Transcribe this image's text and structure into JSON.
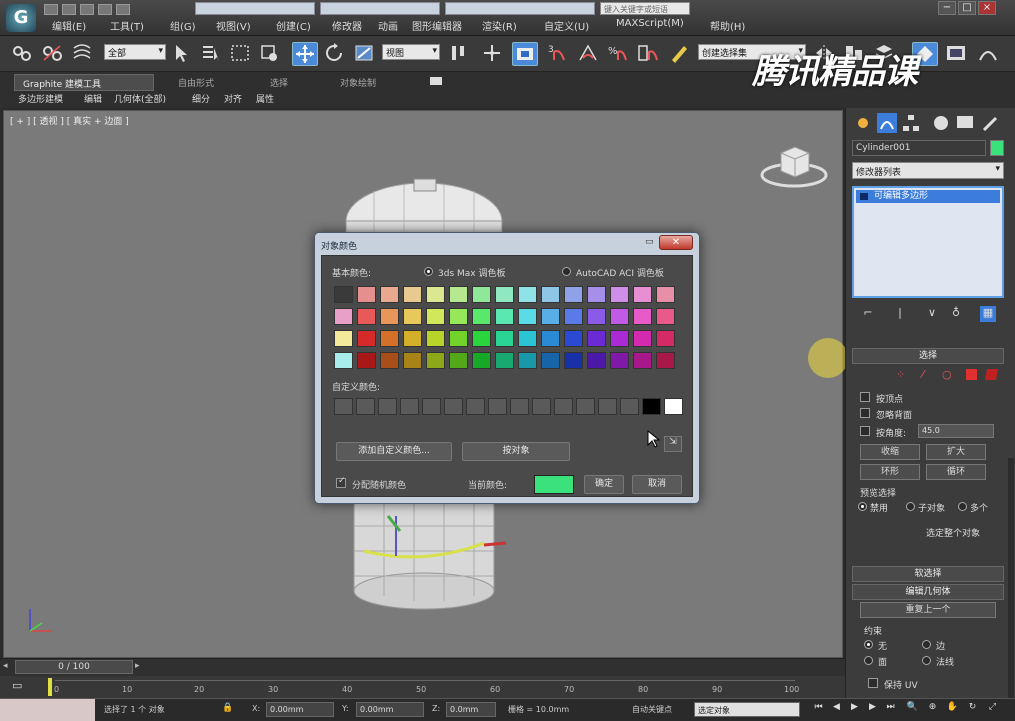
{
  "menubar": {
    "quick_access": [
      "new-icon",
      "open-icon",
      "save-icon",
      "undo-icon",
      "redo-icon"
    ],
    "title_tabs": [
      "",
      "",
      ""
    ],
    "search_placeholder": "键入关键字或短语",
    "items": [
      "编辑(E)",
      "工具(T)",
      "组(G)",
      "视图(V)",
      "创建(C)",
      "修改器",
      "动画",
      "图形编辑器",
      "渲染(R)",
      "自定义(U)",
      "MAXScript(M)",
      "帮助(H)"
    ]
  },
  "toolbar": {
    "filter_value": "全部",
    "ref_coord_value": "视图",
    "named_selection_value": "创建选择集"
  },
  "ribbon": {
    "tabs": [
      "Graphite 建模工具",
      "自由形式",
      "选择",
      "对象绘制"
    ],
    "subtabs": [
      "多边形建模",
      "编辑",
      "几何体(全部)",
      "细分",
      "对齐",
      "属性"
    ],
    "watermark": "腾讯精品课"
  },
  "viewport": {
    "label": "[ + ] [ 透视 ] [ 真实 + 边面 ]"
  },
  "command_panel": {
    "object_name": "Cylinder001",
    "object_color": "#3be27b",
    "modifier_list": "修改器列表",
    "stack_item": "可编辑多边形",
    "selection_title": "选择",
    "by_vertex": "按顶点",
    "ignore_backfacing": "忽略背面",
    "by_angle": "按角度:",
    "angle_value": "45.0",
    "shrink": "收缩",
    "grow": "扩大",
    "ring": "环形",
    "loop": "循环",
    "preview_selection": "预览选择",
    "preview_off": "禁用",
    "preview_subobj": "子对象",
    "preview_multi": "多个",
    "selected_info": "选定整个对象",
    "soft_selection": "软选择",
    "edit_geometry": "编辑几何体",
    "repeat_last": "重复上一个",
    "constraints": "约束",
    "c_none": "无",
    "c_edge": "边",
    "c_face": "面",
    "c_normal": "法线",
    "preserve_uv": "保持 UV"
  },
  "dialog": {
    "title": "对象颜色",
    "basic_colors": "基本颜色:",
    "palette_3dsmax": "3ds Max 调色板",
    "palette_autocad": "AutoCAD ACI 调色板",
    "custom_colors": "自定义颜色:",
    "add_custom": "添加自定义颜色...",
    "by_object": "按对象",
    "assign_random": "分配随机颜色",
    "current_color_label": "当前颜色:",
    "current_color": "#3be27b",
    "ok": "确定",
    "cancel": "取消",
    "swatches": [
      [
        "#3a3a3a",
        "#e58f8f",
        "#e8a98f",
        "#e8c98f",
        "#dbe88f",
        "#b5e88f",
        "#8fe89a",
        "#8fe8c0",
        "#8fe2e8",
        "#8fc6e8",
        "#8fa2e8",
        "#a58fe8",
        "#cf8fe8",
        "#e88fd3",
        "#e88fa8"
      ],
      [
        "#e8a0c8",
        "#e85a5a",
        "#e8965a",
        "#e8c85a",
        "#d0e85a",
        "#96e85a",
        "#5ae86a",
        "#5ae8b0",
        "#5adce8",
        "#5aaee8",
        "#5a7ae8",
        "#8a5ae8",
        "#c25ae8",
        "#e85ac8",
        "#e85a8a"
      ],
      [
        "#f4e89a",
        "#d42a2a",
        "#d4702a",
        "#d4b02a",
        "#b8d42a",
        "#72d42a",
        "#2ad43c",
        "#2ad492",
        "#2ac4d4",
        "#2a8ad4",
        "#2a4ad4",
        "#6a2ad4",
        "#aa2ad4",
        "#d42ab0",
        "#d42a66"
      ],
      [
        "#a8ecec",
        "#a81818",
        "#a84e18",
        "#a88418",
        "#8ca818",
        "#52a818",
        "#18a828",
        "#18a870",
        "#1898a8",
        "#1864a8",
        "#1830a8",
        "#4c18a8",
        "#8018a8",
        "#a8188a",
        "#a81848"
      ]
    ],
    "custom_swatches": [
      "#5a5a5a",
      "#5a5a5a",
      "#5a5a5a",
      "#5a5a5a",
      "#5a5a5a",
      "#5a5a5a",
      "#5a5a5a",
      "#5a5a5a",
      "#5a5a5a",
      "#5a5a5a",
      "#5a5a5a",
      "#5a5a5a",
      "#5a5a5a",
      "#5a5a5a",
      "#000000",
      "#ffffff"
    ]
  },
  "timeline": {
    "frame_display": "0 / 100",
    "ticks": [
      "0",
      "10",
      "20",
      "30",
      "40",
      "50",
      "60",
      "70",
      "80",
      "90",
      "100"
    ]
  },
  "statusbar": {
    "selected": "选择了 1 个 对象",
    "x_value": "0.00mm",
    "y_value": "0.00mm",
    "z_value": "0.0mm",
    "grid": "栅格 = 10.0mm",
    "autokey": "自动关键点",
    "key_filter": "选定对象"
  }
}
